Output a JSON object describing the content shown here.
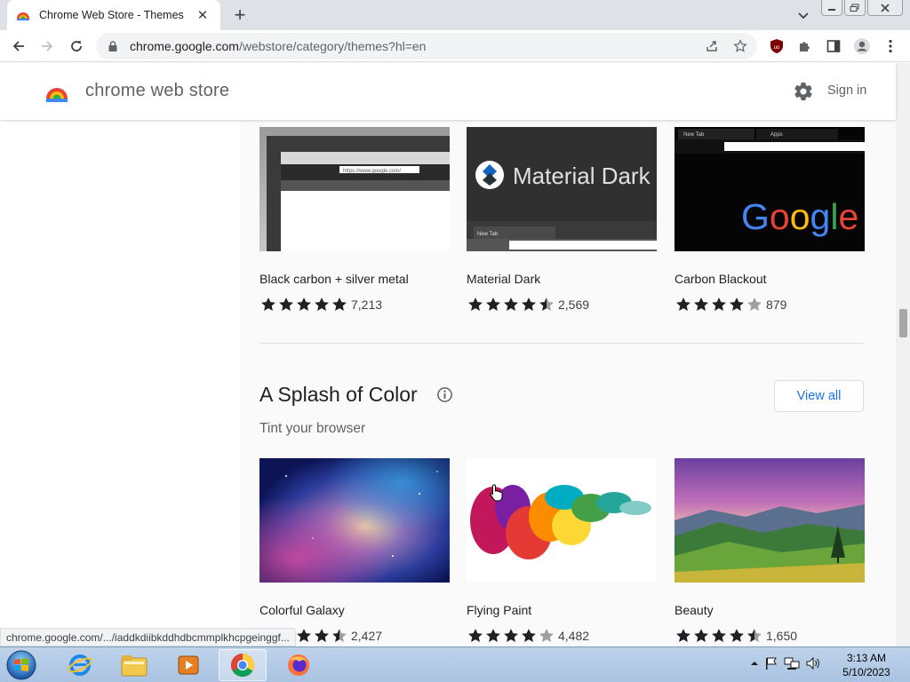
{
  "browser": {
    "tab_title": "Chrome Web Store - Themes",
    "url_host": "chrome.google.com",
    "url_path": "/webstore/category/themes?hl=en",
    "status_url": "chrome.google.com/.../iaddkdiibkddhdbcmmplkhcpgeinggf..."
  },
  "store": {
    "name": "chrome web store",
    "sign_in": "Sign in"
  },
  "top_row": [
    {
      "name": "Black carbon + silver metal",
      "rating": 5,
      "count": "7,213"
    },
    {
      "name": "Material Dark",
      "rating": 4.5,
      "count": "2,569"
    },
    {
      "name": "Carbon Blackout",
      "rating": 4,
      "count": "879"
    }
  ],
  "thumb_text": {
    "material_dark": "Material Dark",
    "google": "Google",
    "new_tab": "New Tab",
    "apps": "Apps",
    "url": "https://www.google.com/"
  },
  "section": {
    "title": "A Splash of Color",
    "subtitle": "Tint your browser",
    "view_all": "View all"
  },
  "splash_row": [
    {
      "name": "Colorful Galaxy",
      "rating": 4.5,
      "count": "2,427"
    },
    {
      "name": "Flying Paint",
      "rating": 4,
      "count": "4,482"
    },
    {
      "name": "Beauty",
      "rating": 4.5,
      "count": "1,650"
    }
  ],
  "taskbar": {
    "time": "3:13 AM",
    "date": "5/10/2023"
  },
  "colors": {
    "accent": "#1a73e8",
    "star": "#202124",
    "star_empty": "#9e9e9e"
  }
}
